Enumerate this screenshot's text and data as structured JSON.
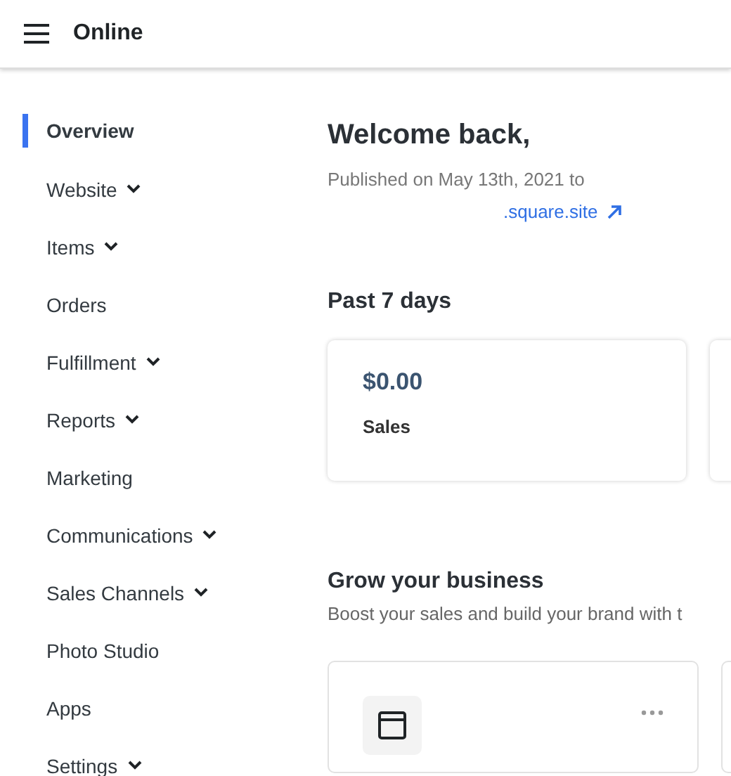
{
  "header": {
    "title": "Online"
  },
  "sidebar": {
    "items": [
      {
        "label": "Overview",
        "selected": true,
        "expandable": false
      },
      {
        "label": "Website",
        "selected": false,
        "expandable": true
      },
      {
        "label": "Items",
        "selected": false,
        "expandable": true
      },
      {
        "label": "Orders",
        "selected": false,
        "expandable": false
      },
      {
        "label": "Fulfillment",
        "selected": false,
        "expandable": true
      },
      {
        "label": "Reports",
        "selected": false,
        "expandable": true
      },
      {
        "label": "Marketing",
        "selected": false,
        "expandable": false
      },
      {
        "label": "Communications",
        "selected": false,
        "expandable": true
      },
      {
        "label": "Sales Channels",
        "selected": false,
        "expandable": true
      },
      {
        "label": "Photo Studio",
        "selected": false,
        "expandable": false
      },
      {
        "label": "Apps",
        "selected": false,
        "expandable": false
      },
      {
        "label": "Settings",
        "selected": false,
        "expandable": true
      }
    ]
  },
  "welcome": {
    "heading": "Welcome back,",
    "published": "Published on May 13th, 2021 to",
    "link": ".square.site"
  },
  "stats": {
    "heading": "Past 7 days",
    "cards": [
      {
        "value": "$0.00",
        "label": "Sales"
      }
    ]
  },
  "grow": {
    "heading": "Grow your business",
    "subtitle": "Boost your sales and build your brand with t"
  }
}
